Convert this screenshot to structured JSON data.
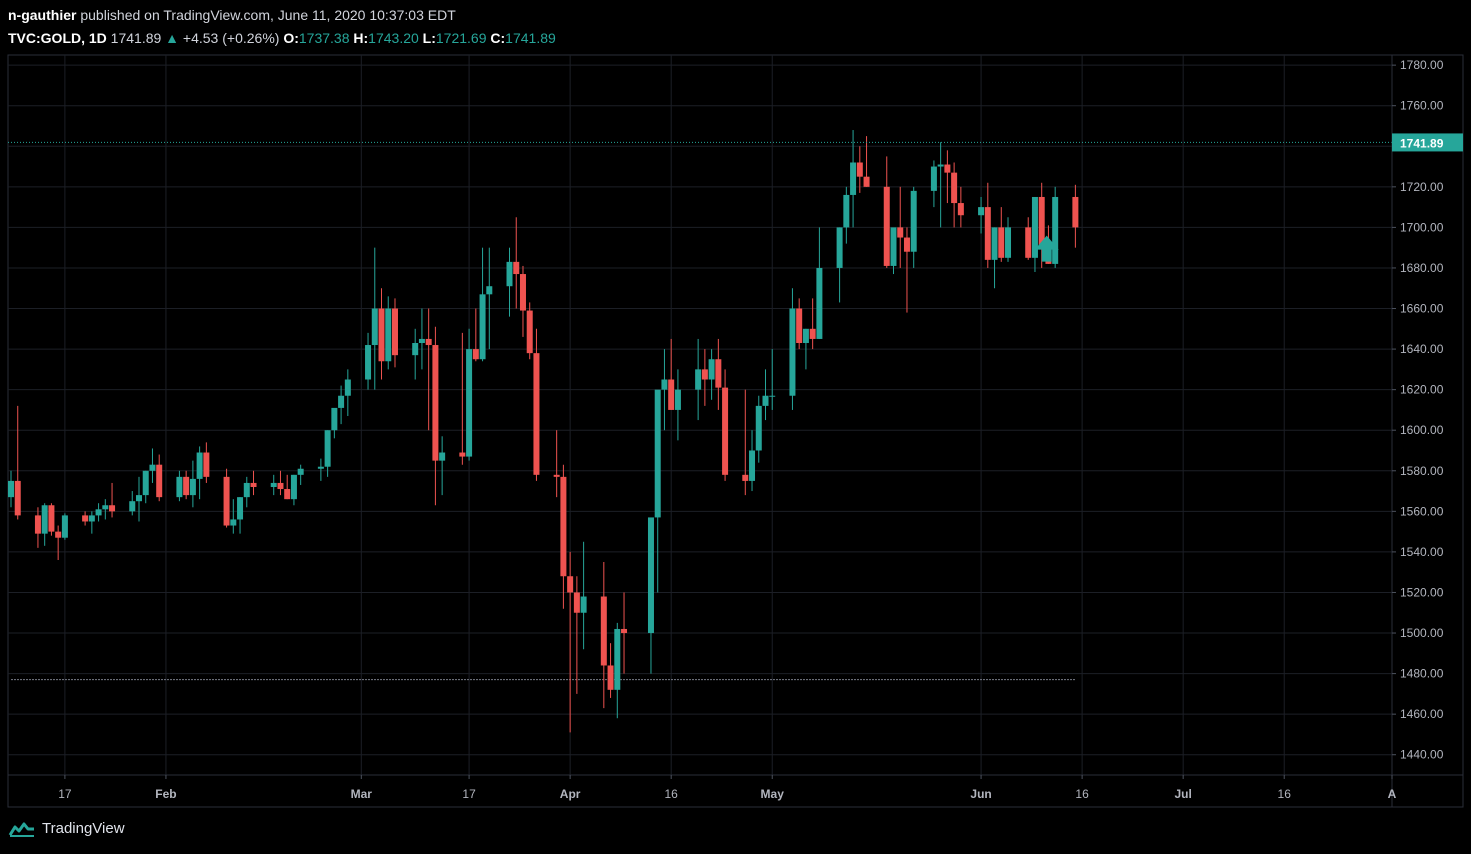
{
  "header": {
    "author": "n-gauthier",
    "published_text": "published on TradingView.com, June 11, 2020 10:37:03 EDT",
    "symbol": "TVC:GOLD, 1D",
    "last": "1741.89",
    "change": "+4.53 (+0.26%)",
    "o_label": "O:",
    "o": "1737.38",
    "h_label": "H:",
    "h": "1743.20",
    "l_label": "L:",
    "l": "1721.69",
    "c_label": "C:",
    "c": "1741.89"
  },
  "footer": {
    "brand": "TradingView"
  },
  "colors": {
    "up": "#26a69a",
    "down": "#ef5350",
    "background": "#000000",
    "grid": "#1c1f26",
    "axis_text": "#b2b5be"
  },
  "chart_data": {
    "type": "candlestick",
    "price_label": "1741.89",
    "ylim": [
      1430,
      1785
    ],
    "y_ticks": [
      "1780.00",
      "1760.00",
      "1740.00",
      "1720.00",
      "1700.00",
      "1680.00",
      "1660.00",
      "1640.00",
      "1620.00",
      "1600.00",
      "1580.00",
      "1560.00",
      "1540.00",
      "1520.00",
      "1500.00",
      "1480.00",
      "1460.00",
      "1440.00"
    ],
    "x_range": [
      "2020-01-09",
      "2020-08-01"
    ],
    "x_ticks": [
      {
        "date": "2020-01-17",
        "label": "17",
        "bold": false
      },
      {
        "date": "2020-02-01",
        "label": "Feb",
        "bold": true
      },
      {
        "date": "2020-03-01",
        "label": "Mar",
        "bold": true
      },
      {
        "date": "2020-03-17",
        "label": "17",
        "bold": false
      },
      {
        "date": "2020-04-01",
        "label": "Apr",
        "bold": true
      },
      {
        "date": "2020-04-16",
        "label": "16",
        "bold": false
      },
      {
        "date": "2020-05-01",
        "label": "May",
        "bold": true
      },
      {
        "date": "2020-06-01",
        "label": "Jun",
        "bold": true
      },
      {
        "date": "2020-06-16",
        "label": "16",
        "bold": false
      },
      {
        "date": "2020-07-01",
        "label": "Jul",
        "bold": true
      },
      {
        "date": "2020-07-16",
        "label": "16",
        "bold": false
      },
      {
        "date": "2020-08-01",
        "label": "A",
        "bold": true
      }
    ],
    "current_price": 1741.89,
    "support_level": 1477,
    "support_range": [
      "2020-01-09",
      "2020-06-15"
    ],
    "arrow_marker": {
      "date": "2020-06-10",
      "price": 1690,
      "direction": "up"
    },
    "candles": [
      {
        "d": "2020-01-09",
        "o": 1567,
        "h": 1580,
        "l": 1562,
        "c": 1575
      },
      {
        "d": "2020-01-10",
        "o": 1575,
        "h": 1612,
        "l": 1556,
        "c": 1558
      },
      {
        "d": "2020-01-13",
        "o": 1558,
        "h": 1562,
        "l": 1542,
        "c": 1549
      },
      {
        "d": "2020-01-14",
        "o": 1549,
        "h": 1564,
        "l": 1543,
        "c": 1563
      },
      {
        "d": "2020-01-15",
        "o": 1563,
        "h": 1564,
        "l": 1548,
        "c": 1550
      },
      {
        "d": "2020-01-16",
        "o": 1550,
        "h": 1553,
        "l": 1536,
        "c": 1547
      },
      {
        "d": "2020-01-17",
        "o": 1547,
        "h": 1559,
        "l": 1546,
        "c": 1558
      },
      {
        "d": "2020-01-20",
        "o": 1558,
        "h": 1560,
        "l": 1553,
        "c": 1555
      },
      {
        "d": "2020-01-21",
        "o": 1555,
        "h": 1560,
        "l": 1549,
        "c": 1558
      },
      {
        "d": "2020-01-22",
        "o": 1558,
        "h": 1564,
        "l": 1555,
        "c": 1561
      },
      {
        "d": "2020-01-23",
        "o": 1561,
        "h": 1566,
        "l": 1556,
        "c": 1563
      },
      {
        "d": "2020-01-24",
        "o": 1563,
        "h": 1574,
        "l": 1557,
        "c": 1560
      },
      {
        "d": "2020-01-27",
        "o": 1560,
        "h": 1570,
        "l": 1558,
        "c": 1565
      },
      {
        "d": "2020-01-28",
        "o": 1565,
        "h": 1577,
        "l": 1555,
        "c": 1568
      },
      {
        "d": "2020-01-29",
        "o": 1568,
        "h": 1580,
        "l": 1564,
        "c": 1580
      },
      {
        "d": "2020-01-30",
        "o": 1580,
        "h": 1591,
        "l": 1574,
        "c": 1583
      },
      {
        "d": "2020-01-31",
        "o": 1583,
        "h": 1588,
        "l": 1565,
        "c": 1567
      },
      {
        "d": "2020-02-03",
        "o": 1567,
        "h": 1580,
        "l": 1565,
        "c": 1577
      },
      {
        "d": "2020-02-04",
        "o": 1577,
        "h": 1580,
        "l": 1566,
        "c": 1568
      },
      {
        "d": "2020-02-05",
        "o": 1568,
        "h": 1585,
        "l": 1562,
        "c": 1576
      },
      {
        "d": "2020-02-06",
        "o": 1576,
        "h": 1592,
        "l": 1566,
        "c": 1589
      },
      {
        "d": "2020-02-07",
        "o": 1589,
        "h": 1594,
        "l": 1574,
        "c": 1577
      },
      {
        "d": "2020-02-10",
        "o": 1577,
        "h": 1581,
        "l": 1552,
        "c": 1553
      },
      {
        "d": "2020-02-11",
        "o": 1553,
        "h": 1566,
        "l": 1549,
        "c": 1556
      },
      {
        "d": "2020-02-12",
        "o": 1556,
        "h": 1567,
        "l": 1549,
        "c": 1567
      },
      {
        "d": "2020-02-13",
        "o": 1567,
        "h": 1577,
        "l": 1562,
        "c": 1574
      },
      {
        "d": "2020-02-14",
        "o": 1574,
        "h": 1580,
        "l": 1568,
        "c": 1572
      },
      {
        "d": "2020-02-17",
        "o": 1572,
        "h": 1578,
        "l": 1568,
        "c": 1574
      },
      {
        "d": "2020-02-18",
        "o": 1574,
        "h": 1580,
        "l": 1568,
        "c": 1571
      },
      {
        "d": "2020-02-19",
        "o": 1571,
        "h": 1578,
        "l": 1566,
        "c": 1566
      },
      {
        "d": "2020-02-20",
        "o": 1566,
        "h": 1578,
        "l": 1563,
        "c": 1578
      },
      {
        "d": "2020-02-21",
        "o": 1578,
        "h": 1583,
        "l": 1573,
        "c": 1581
      },
      {
        "d": "2020-02-24",
        "o": 1581,
        "h": 1586,
        "l": 1575,
        "c": 1582
      },
      {
        "d": "2020-02-25",
        "o": 1582,
        "h": 1600,
        "l": 1577,
        "c": 1600
      },
      {
        "d": "2020-02-26",
        "o": 1600,
        "h": 1610,
        "l": 1596,
        "c": 1611
      },
      {
        "d": "2020-02-27",
        "o": 1611,
        "h": 1622,
        "l": 1603,
        "c": 1617
      },
      {
        "d": "2020-02-28",
        "o": 1617,
        "h": 1630,
        "l": 1607,
        "c": 1625
      },
      {
        "d": "2020-03-02",
        "o": 1625,
        "h": 1648,
        "l": 1620,
        "c": 1642
      },
      {
        "d": "2020-03-03",
        "o": 1642,
        "h": 1690,
        "l": 1620,
        "c": 1660
      },
      {
        "d": "2020-03-04",
        "o": 1660,
        "h": 1670,
        "l": 1625,
        "c": 1634
      },
      {
        "d": "2020-03-05",
        "o": 1634,
        "h": 1666,
        "l": 1630,
        "c": 1660
      },
      {
        "d": "2020-03-06",
        "o": 1660,
        "h": 1665,
        "l": 1631,
        "c": 1637
      },
      {
        "d": "2020-03-09",
        "o": 1637,
        "h": 1650,
        "l": 1625,
        "c": 1643
      },
      {
        "d": "2020-03-10",
        "o": 1643,
        "h": 1660,
        "l": 1630,
        "c": 1645
      },
      {
        "d": "2020-03-11",
        "o": 1645,
        "h": 1660,
        "l": 1600,
        "c": 1642
      },
      {
        "d": "2020-03-12",
        "o": 1642,
        "h": 1651,
        "l": 1563,
        "c": 1585
      },
      {
        "d": "2020-03-13",
        "o": 1585,
        "h": 1597,
        "l": 1568,
        "c": 1589
      },
      {
        "d": "2020-03-16",
        "o": 1589,
        "h": 1648,
        "l": 1583,
        "c": 1587
      },
      {
        "d": "2020-03-17",
        "o": 1587,
        "h": 1650,
        "l": 1585,
        "c": 1640
      },
      {
        "d": "2020-03-18",
        "o": 1640,
        "h": 1660,
        "l": 1634,
        "c": 1635
      },
      {
        "d": "2020-03-19",
        "o": 1635,
        "h": 1690,
        "l": 1634,
        "c": 1667
      },
      {
        "d": "2020-03-20",
        "o": 1667,
        "h": 1690,
        "l": 1640,
        "c": 1671
      },
      {
        "d": "2020-03-23",
        "o": 1671,
        "h": 1690,
        "l": 1656,
        "c": 1683
      },
      {
        "d": "2020-03-24",
        "o": 1683,
        "h": 1705,
        "l": 1660,
        "c": 1677
      },
      {
        "d": "2020-03-25",
        "o": 1677,
        "h": 1681,
        "l": 1646,
        "c": 1659
      },
      {
        "d": "2020-03-26",
        "o": 1659,
        "h": 1663,
        "l": 1635,
        "c": 1638
      },
      {
        "d": "2020-03-27",
        "o": 1638,
        "h": 1650,
        "l": 1575,
        "c": 1578
      },
      {
        "d": "2020-03-30",
        "o": 1578,
        "h": 1600,
        "l": 1567,
        "c": 1577
      },
      {
        "d": "2020-03-31",
        "o": 1577,
        "h": 1583,
        "l": 1512,
        "c": 1528
      },
      {
        "d": "2020-04-01",
        "o": 1528,
        "h": 1540,
        "l": 1451,
        "c": 1520
      },
      {
        "d": "2020-04-02",
        "o": 1520,
        "h": 1528,
        "l": 1470,
        "c": 1510
      },
      {
        "d": "2020-04-03",
        "o": 1510,
        "h": 1545,
        "l": 1492,
        "c": 1518
      },
      {
        "d": "2020-04-06",
        "o": 1518,
        "h": 1535,
        "l": 1463,
        "c": 1484
      },
      {
        "d": "2020-04-07",
        "o": 1484,
        "h": 1495,
        "l": 1468,
        "c": 1472
      },
      {
        "d": "2020-04-08",
        "o": 1472,
        "h": 1505,
        "l": 1458,
        "c": 1502
      },
      {
        "d": "2020-04-09",
        "o": 1502,
        "h": 1520,
        "l": 1480,
        "c": 1500
      },
      {
        "d": "2020-04-13",
        "o": 1500,
        "h": 1550,
        "l": 1480,
        "c": 1557
      },
      {
        "d": "2020-04-14",
        "o": 1557,
        "h": 1610,
        "l": 1520,
        "c": 1620
      },
      {
        "d": "2020-04-15",
        "o": 1620,
        "h": 1640,
        "l": 1600,
        "c": 1625
      },
      {
        "d": "2020-04-16",
        "o": 1625,
        "h": 1645,
        "l": 1610,
        "c": 1610
      },
      {
        "d": "2020-04-17",
        "o": 1610,
        "h": 1630,
        "l": 1595,
        "c": 1620
      },
      {
        "d": "2020-04-20",
        "o": 1620,
        "h": 1645,
        "l": 1605,
        "c": 1630
      },
      {
        "d": "2020-04-21",
        "o": 1630,
        "h": 1640,
        "l": 1612,
        "c": 1625
      },
      {
        "d": "2020-04-22",
        "o": 1625,
        "h": 1640,
        "l": 1615,
        "c": 1635
      },
      {
        "d": "2020-04-23",
        "o": 1635,
        "h": 1645,
        "l": 1610,
        "c": 1621
      },
      {
        "d": "2020-04-24",
        "o": 1621,
        "h": 1630,
        "l": 1575,
        "c": 1578
      },
      {
        "d": "2020-04-27",
        "o": 1578,
        "h": 1620,
        "l": 1568,
        "c": 1575
      },
      {
        "d": "2020-04-28",
        "o": 1575,
        "h": 1600,
        "l": 1570,
        "c": 1590
      },
      {
        "d": "2020-04-29",
        "o": 1590,
        "h": 1617,
        "l": 1584,
        "c": 1612
      },
      {
        "d": "2020-04-30",
        "o": 1612,
        "h": 1630,
        "l": 1605,
        "c": 1617
      },
      {
        "d": "2020-05-01",
        "o": 1617,
        "h": 1640,
        "l": 1610,
        "c": 1617
      },
      {
        "d": "2020-05-04",
        "o": 1617,
        "h": 1670,
        "l": 1610,
        "c": 1660
      },
      {
        "d": "2020-05-05",
        "o": 1660,
        "h": 1665,
        "l": 1640,
        "c": 1643
      },
      {
        "d": "2020-05-06",
        "o": 1643,
        "h": 1650,
        "l": 1630,
        "c": 1650
      },
      {
        "d": "2020-05-07",
        "o": 1650,
        "h": 1665,
        "l": 1640,
        "c": 1645
      },
      {
        "d": "2020-05-08",
        "o": 1645,
        "h": 1700,
        "l": 1645,
        "c": 1680
      },
      {
        "d": "2020-05-11",
        "o": 1680,
        "h": 1700,
        "l": 1663,
        "c": 1700
      },
      {
        "d": "2020-05-12",
        "o": 1700,
        "h": 1720,
        "l": 1692,
        "c": 1716
      },
      {
        "d": "2020-05-13",
        "o": 1716,
        "h": 1748,
        "l": 1700,
        "c": 1732
      },
      {
        "d": "2020-05-14",
        "o": 1732,
        "h": 1740,
        "l": 1717,
        "c": 1725
      },
      {
        "d": "2020-05-15",
        "o": 1725,
        "h": 1745,
        "l": 1720,
        "c": 1720
      },
      {
        "d": "2020-05-18",
        "o": 1720,
        "h": 1735,
        "l": 1680,
        "c": 1681
      },
      {
        "d": "2020-05-19",
        "o": 1681,
        "h": 1695,
        "l": 1677,
        "c": 1700
      },
      {
        "d": "2020-05-20",
        "o": 1700,
        "h": 1720,
        "l": 1680,
        "c": 1695
      },
      {
        "d": "2020-05-21",
        "o": 1695,
        "h": 1700,
        "l": 1658,
        "c": 1688
      },
      {
        "d": "2020-05-22",
        "o": 1688,
        "h": 1720,
        "l": 1680,
        "c": 1718
      },
      {
        "d": "2020-05-25",
        "o": 1718,
        "h": 1733,
        "l": 1710,
        "c": 1730
      },
      {
        "d": "2020-05-26",
        "o": 1730,
        "h": 1742,
        "l": 1700,
        "c": 1731
      },
      {
        "d": "2020-05-27",
        "o": 1731,
        "h": 1738,
        "l": 1712,
        "c": 1727
      },
      {
        "d": "2020-05-28",
        "o": 1727,
        "h": 1732,
        "l": 1700,
        "c": 1712
      },
      {
        "d": "2020-05-29",
        "o": 1712,
        "h": 1720,
        "l": 1700,
        "c": 1706
      },
      {
        "d": "2020-06-01",
        "o": 1706,
        "h": 1715,
        "l": 1697,
        "c": 1710
      },
      {
        "d": "2020-06-02",
        "o": 1710,
        "h": 1722,
        "l": 1680,
        "c": 1684
      },
      {
        "d": "2020-06-03",
        "o": 1684,
        "h": 1700,
        "l": 1670,
        "c": 1700
      },
      {
        "d": "2020-06-04",
        "o": 1700,
        "h": 1710,
        "l": 1683,
        "c": 1685
      },
      {
        "d": "2020-06-05",
        "o": 1685,
        "h": 1705,
        "l": 1683,
        "c": 1700
      },
      {
        "d": "2020-06-08",
        "o": 1700,
        "h": 1705,
        "l": 1684,
        "c": 1685
      },
      {
        "d": "2020-06-09",
        "o": 1685,
        "h": 1700,
        "l": 1678,
        "c": 1715
      },
      {
        "d": "2020-06-10",
        "o": 1715,
        "h": 1722,
        "l": 1680,
        "c": 1690
      },
      {
        "d": "2020-06-11",
        "o": 1690,
        "h": 1701,
        "l": 1682,
        "c": 1682
      },
      {
        "d": "2020-06-12",
        "o": 1682,
        "h": 1720,
        "l": 1680,
        "c": 1715
      },
      {
        "d": "2020-06-15",
        "o": 1715,
        "h": 1721,
        "l": 1690,
        "c": 1700
      }
    ]
  }
}
